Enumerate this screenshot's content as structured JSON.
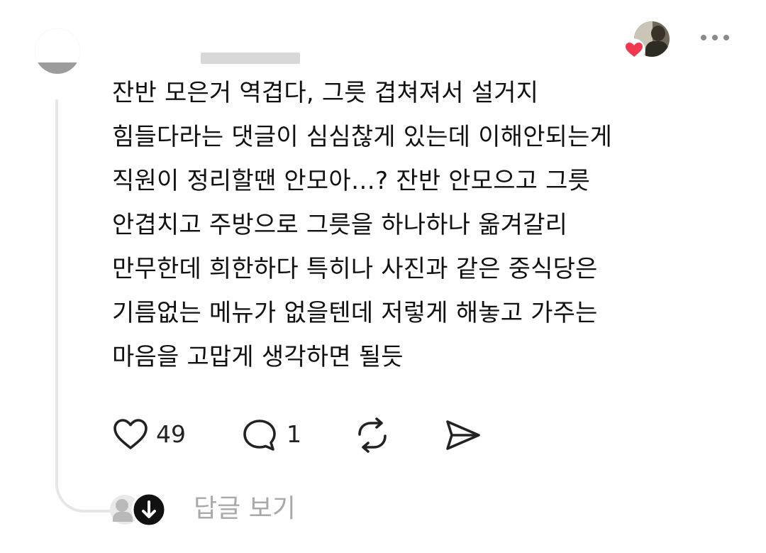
{
  "post": {
    "comment_lines": [
      "잔반 모은거 역겹다, 그릇 겹쳐져서 설거지",
      "힘들다라는 댓글이 심심찮게 있는데 이해안되는게",
      "직원이 정리할땐 안모아…? 잔반 안모으고 그릇",
      "안겹치고 주방으로 그릇을 하나하나 옮겨갈리",
      "만무한데 희한하다 특히나 사진과 같은 중식당은",
      "기름없는 메뉴가 없을텐데 저렇게 해놓고 가주는",
      "마음을 고맙게 생각하면 될듯"
    ],
    "comment_text": "잔반 모은거 역겹다, 그릇 겹쳐져서 설거지\n힘들다라는 댓글이 심심찮게 있는데 이해안되는게\n직원이 정리할땐 안모아…? 잔반 안모으고 그릇\n안겹치고 주방으로 그릇을 하나하나 옮겨갈리\n만무한데 희한하다 특히나 사진과 같은 중식당은\n기름없는 메뉴가 없을텐데 저렇게 해놓고 가주는\n마음을 고맙게 생각하면 될듯"
  },
  "actions": {
    "like_count": "49",
    "reply_count": "1",
    "like_icon": "heart-outline-icon",
    "reply_icon": "speech-bubble-icon",
    "repost_icon": "repost-icon",
    "share_icon": "send-icon"
  },
  "replies": {
    "label": "답글 보기",
    "icon": "arrow-down-icon"
  },
  "header": {
    "more_icon": "more-horizontal-icon",
    "liked_badge_icon": "heart-filled-icon"
  },
  "colors": {
    "text": "#111111",
    "muted": "#a9a9a9",
    "heart_badge": "#f0394f",
    "thread_line": "#e6e6e6"
  }
}
